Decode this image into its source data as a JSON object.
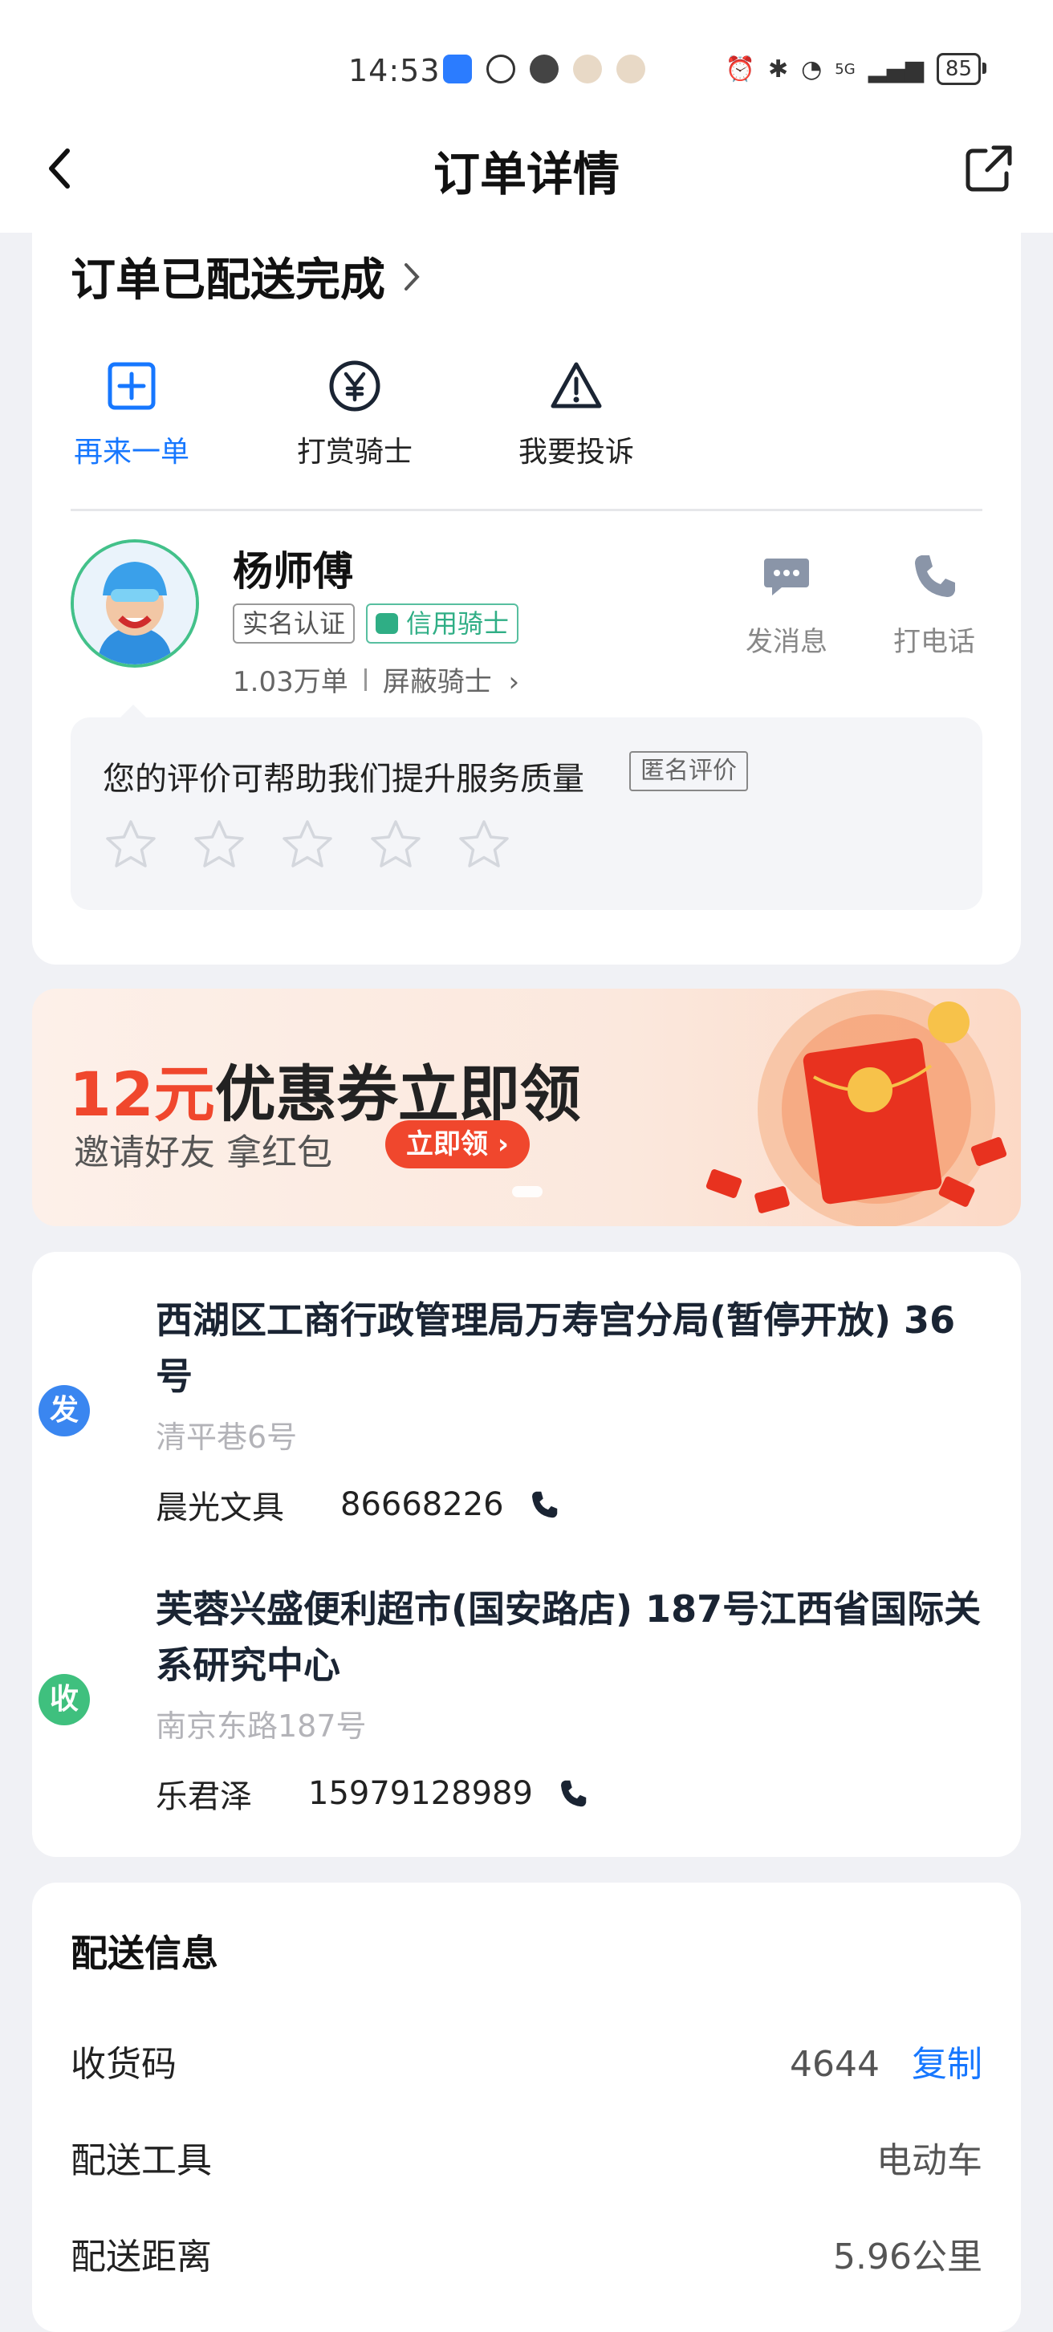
{
  "status_bar": {
    "time": "14:53",
    "battery": "85",
    "network": "5G"
  },
  "header": {
    "title": "订单详情"
  },
  "order": {
    "status_title": "订单已配送完成",
    "actions": [
      {
        "label": "再来一单",
        "icon": "plus-square-icon"
      },
      {
        "label": "打赏骑士",
        "icon": "yen-circle-icon"
      },
      {
        "label": "我要投诉",
        "icon": "warning-triangle-icon"
      }
    ]
  },
  "rider": {
    "name": "杨师傅",
    "tag_verified": "实名认证",
    "tag_credit": "信用骑士",
    "orders": "1.03万单",
    "block": "屏蔽骑士",
    "message_label": "发消息",
    "call_label": "打电话"
  },
  "rating": {
    "prompt": "您的评价可帮助我们提升服务质量",
    "anonymous_tag": "匿名评价",
    "stars_filled": 0,
    "stars_total": 5
  },
  "banner": {
    "amount": "12元",
    "title_rest": "优惠券立即领",
    "subtitle": "邀请好友 拿红包",
    "button": "立即领"
  },
  "addresses": {
    "sender": {
      "badge": "发",
      "name": "西湖区工商行政管理局万寿宫分局(暂停开放) 36号",
      "sub": "清平巷6号",
      "contact": "晨光文具",
      "phone": "86668226"
    },
    "receiver": {
      "badge": "收",
      "name": "芙蓉兴盛便利超市(国安路店) 187号江西省国际关系研究中心",
      "sub": "南京东路187号",
      "contact": "乐君泽",
      "phone": "15979128989"
    }
  },
  "delivery_info": {
    "title": "配送信息",
    "rows": [
      {
        "label": "收货码",
        "value": "4644",
        "action": "复制"
      },
      {
        "label": "配送工具",
        "value": "电动车"
      },
      {
        "label": "配送距离",
        "value": "5.96公里"
      }
    ]
  },
  "colors": {
    "accent_blue": "#1677ff",
    "promo_red": "#f0472d",
    "rider_green": "#2fae85"
  }
}
